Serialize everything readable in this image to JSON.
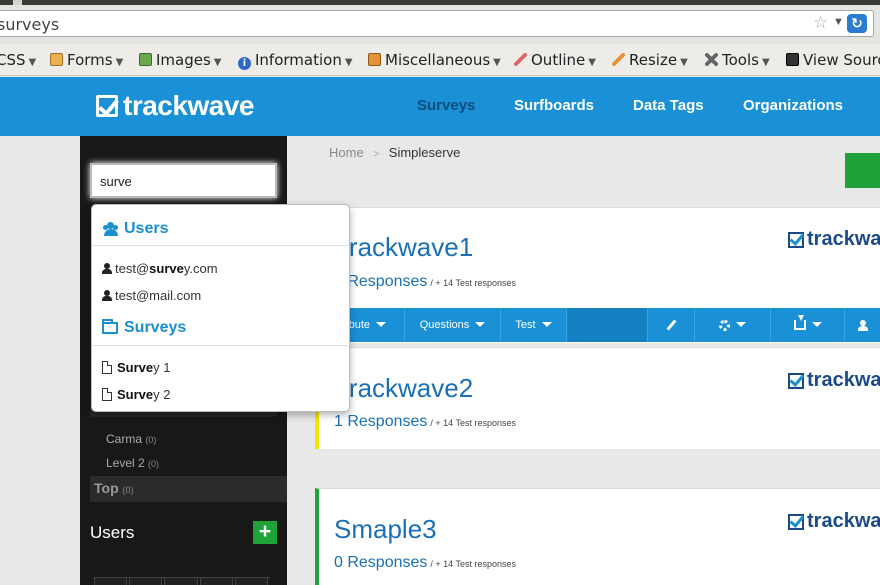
{
  "browser": {
    "url": "surveys",
    "bookmarks": [
      {
        "label": "CSS"
      },
      {
        "label": "Forms"
      },
      {
        "label": "Images"
      },
      {
        "label": "Information"
      },
      {
        "label": "Miscellaneous"
      },
      {
        "label": "Outline"
      },
      {
        "label": "Resize"
      },
      {
        "label": "Tools"
      },
      {
        "label": "View Sourc"
      }
    ]
  },
  "header": {
    "logo": "trackwave",
    "nav": [
      {
        "label": "Surveys"
      },
      {
        "label": "Surfboards"
      },
      {
        "label": "Data Tags"
      },
      {
        "label": "Organizations"
      }
    ]
  },
  "sidebar": {
    "search_value": "surve",
    "items": [
      {
        "label": "Carma",
        "count": "(0)"
      },
      {
        "label": "Level 2",
        "count": "(0)"
      }
    ],
    "top": {
      "label": "Top",
      "count": "(0)"
    },
    "users_label": "Users",
    "add_label": "+"
  },
  "dropdown": {
    "users_heading": "Users",
    "users": [
      {
        "prefix": "test@",
        "match": "surve",
        "suffix": "y.com"
      },
      {
        "prefix": "test@mail.com",
        "match": "",
        "suffix": ""
      }
    ],
    "surveys_heading": "Surveys",
    "surveys": [
      {
        "match": "Surve",
        "suffix": "y 1"
      },
      {
        "match": "Surve",
        "suffix": "y 2"
      }
    ]
  },
  "breadcrumb": {
    "home": "Home",
    "sep": ">",
    "current": "Simpleserve"
  },
  "surveys": [
    {
      "title": "Trackwave1",
      "responses": "0 Responses",
      "test": "/ + 14 Test responses",
      "accent": ""
    },
    {
      "title": "Trackwave2",
      "responses": "1 Responses",
      "test": "/ + 14 Test responses",
      "accent": "#f2e600"
    },
    {
      "title": "Smaple3",
      "responses": "0 Responses",
      "test": "/ + 14 Test responses",
      "accent": "#1fa23a"
    }
  ],
  "brand": "trackwave",
  "toolbar": {
    "distribute": "Distribute",
    "questions": "Questions",
    "test": "Test"
  },
  "colors": {
    "header": "#1a90d6",
    "link": "#1a70b8",
    "add_green": "#1fa23a"
  }
}
